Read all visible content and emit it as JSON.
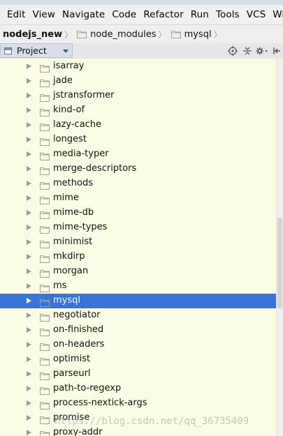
{
  "menu": [
    "Edit",
    "View",
    "Navigate",
    "Code",
    "Refactor",
    "Run",
    "Tools",
    "VCS",
    "Window"
  ],
  "breadcrumb": {
    "root": "nodejs_new",
    "items": [
      "node_modules",
      "mysql"
    ]
  },
  "toolwindow": {
    "label": "Project"
  },
  "tree": {
    "selected_index": 16,
    "items": [
      "isarray",
      "jade",
      "jstransformer",
      "kind-of",
      "lazy-cache",
      "longest",
      "media-typer",
      "merge-descriptors",
      "methods",
      "mime",
      "mime-db",
      "mime-types",
      "minimist",
      "mkdirp",
      "morgan",
      "ms",
      "mysql",
      "negotiator",
      "on-finished",
      "on-headers",
      "optimist",
      "parseurl",
      "path-to-regexp",
      "process-nextick-args",
      "promise",
      "proxy-addr"
    ]
  },
  "watermark": "https://blog.csdn.net/qq_36735409",
  "colors": {
    "tree_bg": "#fbfce6",
    "selection": "#3875d7",
    "folder": "#a4a190"
  },
  "icons": [
    "folder-icon",
    "target-icon",
    "collapse-icon",
    "gear-icon",
    "hide-icon"
  ]
}
